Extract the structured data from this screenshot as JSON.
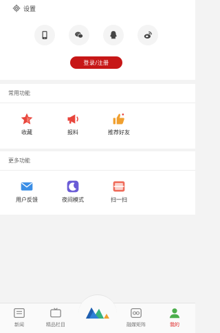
{
  "header": {
    "settings_label": "设置",
    "settings_icon": "gear-icon"
  },
  "login": {
    "providers": [
      {
        "name": "phone-icon"
      },
      {
        "name": "wechat-icon"
      },
      {
        "name": "qq-icon"
      },
      {
        "name": "weibo-icon"
      }
    ],
    "button_label": "登录/注册",
    "accent": "#c71717"
  },
  "common": {
    "title": "常用功能",
    "items": [
      {
        "label": "收藏",
        "icon": "star-icon"
      },
      {
        "label": "报料",
        "icon": "megaphone-icon"
      },
      {
        "label": "推荐好友",
        "icon": "thumbs-up-icon"
      }
    ]
  },
  "more": {
    "title": "更多功能",
    "items": [
      {
        "label": "用户反馈",
        "icon": "mail-icon"
      },
      {
        "label": "夜间模式",
        "icon": "moon-icon"
      },
      {
        "label": "扫一扫",
        "icon": "scan-icon"
      }
    ]
  },
  "tabbar": {
    "items": [
      {
        "label": "新闻",
        "icon": "news-icon"
      },
      {
        "label": "精品栏目",
        "icon": "tv-icon"
      },
      {
        "label": "",
        "icon": "logo-icon"
      },
      {
        "label": "融媒矩阵",
        "icon": "matrix-icon"
      },
      {
        "label": "我的",
        "icon": "user-icon",
        "active": true
      }
    ]
  }
}
